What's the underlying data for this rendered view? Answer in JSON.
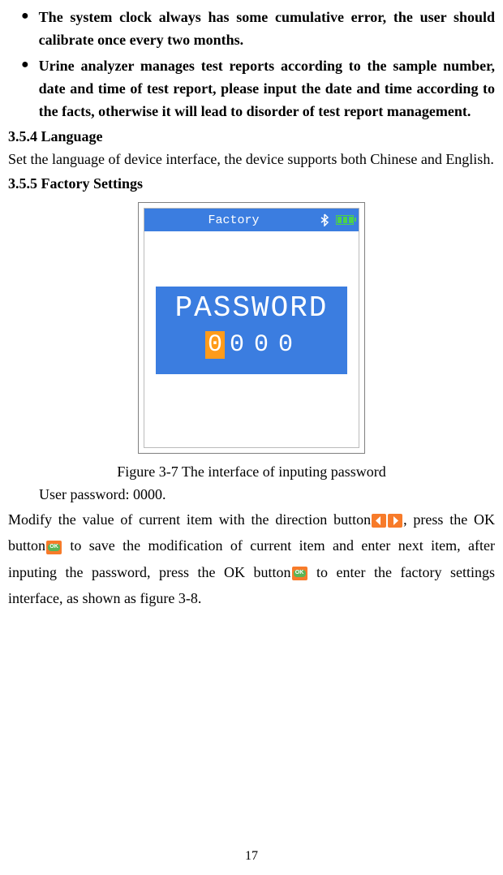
{
  "bullets": [
    "The system clock always has some cumulative error, the user should calibrate once every two months.",
    "Urine analyzer manages test reports according to the sample number, date and time of test report, please input the date and time according to the facts, otherwise it will lead to disorder of test report management."
  ],
  "sections": {
    "language": {
      "heading": "3.5.4 Language",
      "body": "Set the language of device interface, the device supports both Chinese and English."
    },
    "factory": {
      "heading": "3.5.5 Factory Settings",
      "device_title": "Factory",
      "password_label": "PASSWORD",
      "password_digits": [
        "0",
        "0",
        "0",
        "0"
      ],
      "caption": "Figure 3-7 The interface of inputing password",
      "user_password_line": "User password: 0000.",
      "para_part1": "Modify the value of current item with the direction button",
      "para_part2": ", press the OK button",
      "para_part3": " to save the modification of current item and enter next item, after inputing the password, press the OK button",
      "para_part4": " to enter the factory settings interface, as shown as figure 3-8."
    }
  },
  "page_number": "17"
}
